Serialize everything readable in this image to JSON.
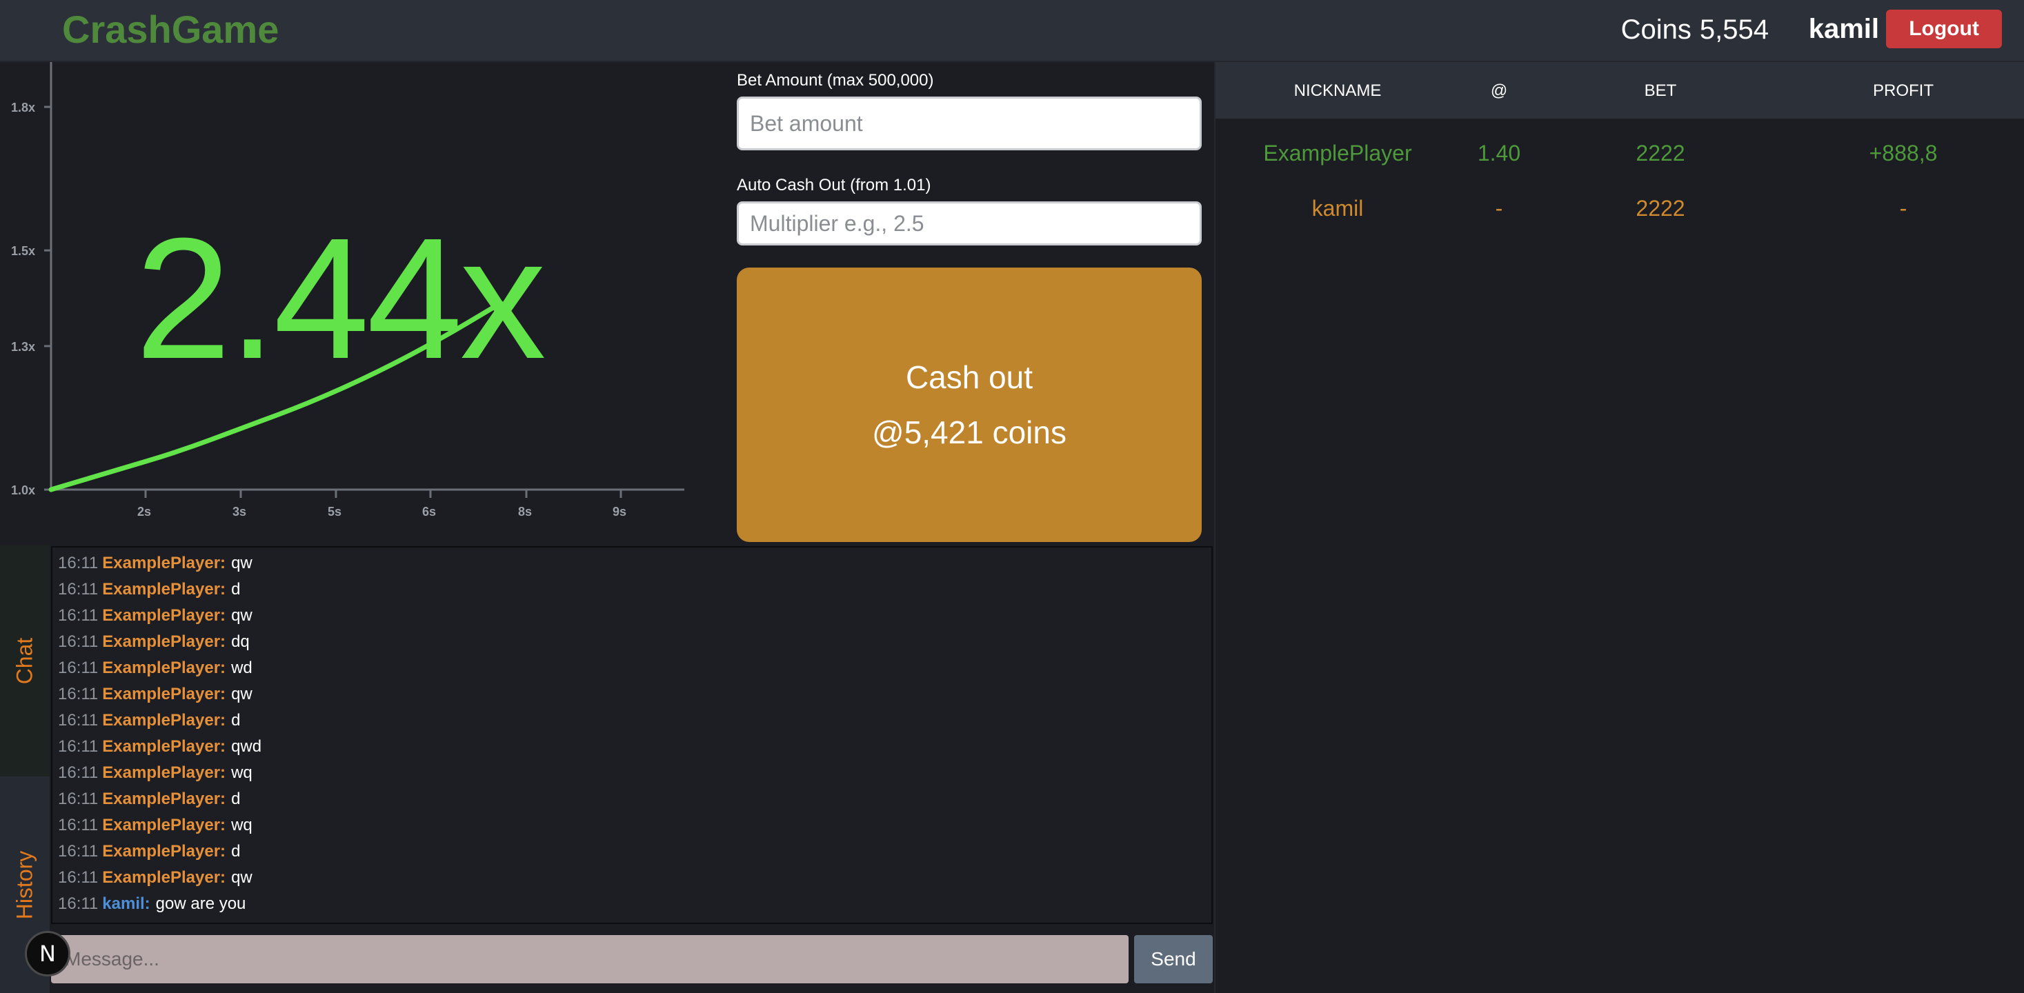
{
  "header": {
    "brand": "CrashGame",
    "coins_label": "Coins",
    "coins_value": "5,554",
    "username": "kamil",
    "logout_label": "Logout"
  },
  "game": {
    "multiplier": "2.44x",
    "curve_color": "#62e34a"
  },
  "chart_data": {
    "type": "line",
    "y_ticks": [
      "1.0x",
      "1.3x",
      "1.5x",
      "1.8x"
    ],
    "x_ticks": [
      "2s",
      "3s",
      "5s",
      "6s",
      "8s",
      "9s"
    ],
    "series": [
      {
        "x": [
          0,
          1,
          2,
          3,
          4,
          5,
          6,
          7
        ],
        "y": [
          1.0,
          1.04,
          1.08,
          1.13,
          1.18,
          1.24,
          1.31,
          1.39
        ]
      }
    ]
  },
  "form": {
    "bet_label": "Bet Amount (max 500,000)",
    "bet_placeholder": "Bet amount",
    "bet_value": "",
    "auto_label": "Auto Cash Out (from 1.01)",
    "auto_placeholder": "Multiplier e.g., 2.5",
    "auto_value": "",
    "cashout_line1": "Cash out",
    "cashout_line2": "@5,421 coins"
  },
  "leaderboard": {
    "headers": [
      "NICKNAME",
      "@",
      "BET",
      "PROFIT"
    ],
    "rows": [
      {
        "nickname": "ExamplePlayer",
        "at": "1.40",
        "bet": "2222",
        "profit": "+888,8",
        "color": "#4e9a3a"
      },
      {
        "nickname": "kamil",
        "at": "-",
        "bet": "2222",
        "profit": "-",
        "color": "#d08a2e"
      }
    ]
  },
  "tabs": {
    "chat": "Chat",
    "history": "History"
  },
  "chat": {
    "messages": [
      {
        "time": "16:11",
        "user": "ExamplePlayer:",
        "text": "qw"
      },
      {
        "time": "16:11",
        "user": "ExamplePlayer:",
        "text": "d"
      },
      {
        "time": "16:11",
        "user": "ExamplePlayer:",
        "text": "qw"
      },
      {
        "time": "16:11",
        "user": "ExamplePlayer:",
        "text": "dq"
      },
      {
        "time": "16:11",
        "user": "ExamplePlayer:",
        "text": "wd"
      },
      {
        "time": "16:11",
        "user": "ExamplePlayer:",
        "text": "qw"
      },
      {
        "time": "16:11",
        "user": "ExamplePlayer:",
        "text": "d"
      },
      {
        "time": "16:11",
        "user": "ExamplePlayer:",
        "text": "qwd"
      },
      {
        "time": "16:11",
        "user": "ExamplePlayer:",
        "text": "wq"
      },
      {
        "time": "16:11",
        "user": "ExamplePlayer:",
        "text": "d"
      },
      {
        "time": "16:11",
        "user": "ExamplePlayer:",
        "text": "wq"
      },
      {
        "time": "16:11",
        "user": "ExamplePlayer:",
        "text": "d"
      },
      {
        "time": "16:11",
        "user": "ExamplePlayer:",
        "text": "qw"
      },
      {
        "time": "16:11",
        "user": "kamil:",
        "text": "gow are you",
        "self": true
      }
    ],
    "input_placeholder": "Message...",
    "input_value": "",
    "send_label": "Send"
  },
  "badge": {
    "letter": "N"
  }
}
